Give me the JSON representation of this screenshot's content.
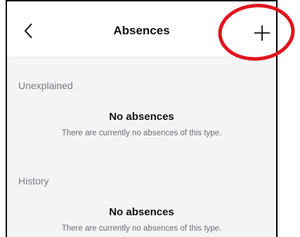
{
  "header": {
    "title": "Absences",
    "back_icon": "chevron-left-icon",
    "add_icon": "plus-icon"
  },
  "sections": [
    {
      "label": "Unexplained",
      "empty_title": "No absences",
      "empty_message": "There are currently no absences of this type."
    },
    {
      "label": "History",
      "empty_title": "No absences",
      "empty_message": "There are currently no absences of this type."
    }
  ],
  "annotation": {
    "color": "#e0141e"
  }
}
